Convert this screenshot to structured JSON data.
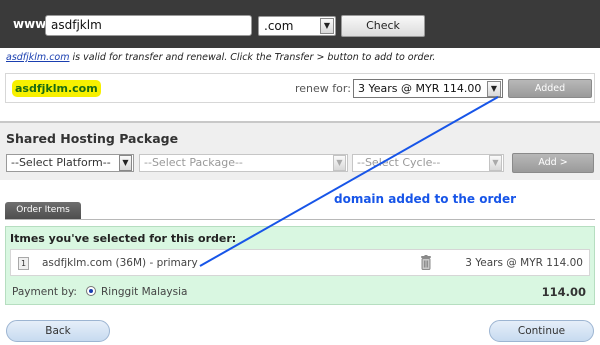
{
  "search": {
    "www_label": "www.",
    "domain_value": "asdfjklm",
    "tld_value": ".com",
    "check_label": "Check"
  },
  "status": {
    "domain_link": "asdfjklm.com",
    "message": " is valid for transfer and renewal. Click the Transfer > button to add to order."
  },
  "domain_row": {
    "domain": "asdfjklm.com",
    "renew_label": "renew for:",
    "renew_value": "3 Years @ MYR 114.00",
    "added_label": "Added"
  },
  "hosting": {
    "title": "Shared Hosting Package",
    "platform_placeholder": "--Select Platform--",
    "package_placeholder": "--Select Package--",
    "cycle_placeholder": "--Select Cycle--",
    "add_label": "Add >"
  },
  "tabs": {
    "order_items": "Order Items"
  },
  "annotation": "domain added to the order",
  "order": {
    "title": "Itmes you've selected for this order:",
    "items": [
      {
        "num": "1",
        "name": "asdfjklm.com (36M) - primary",
        "price": "3 Years @ MYR 114.00"
      }
    ],
    "payment_label": "Payment by:",
    "payment_method": "Ringgit Malaysia",
    "total": "114.00"
  },
  "footer": {
    "back_label": "Back",
    "continue_label": "Continue"
  },
  "colors": {
    "topbar": "#3a3a3a",
    "highlight": "#f7f000",
    "domain_text": "#1a6b13",
    "order_panel": "#d9f7e1",
    "annotation": "#1755e8",
    "button_blue": "#c7dbf0"
  }
}
